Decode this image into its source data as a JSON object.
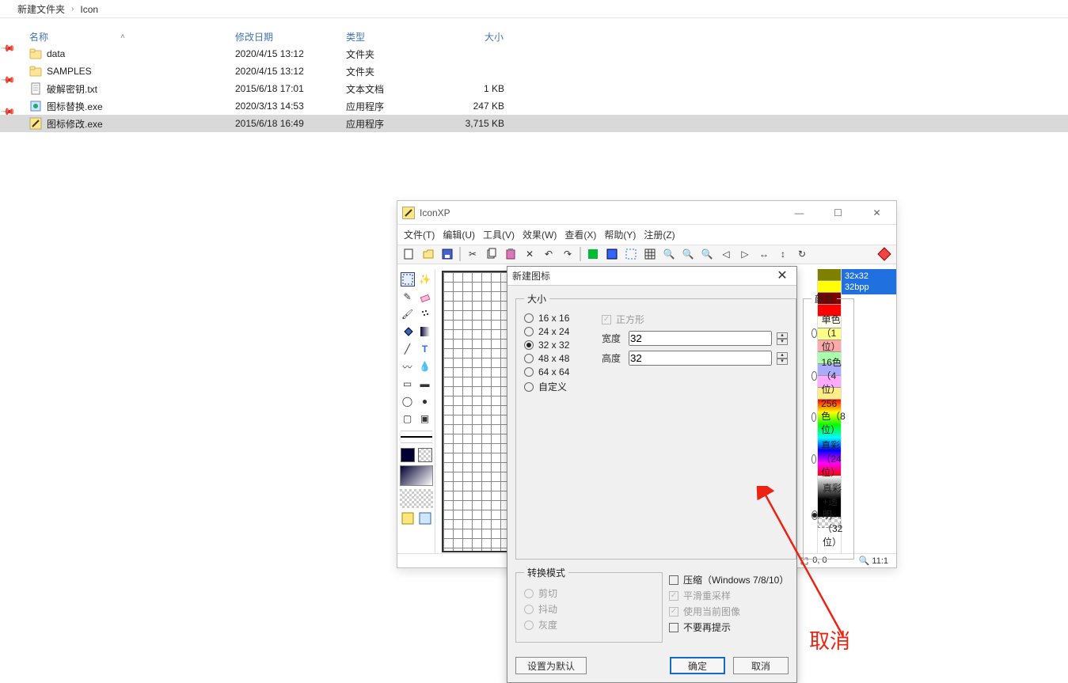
{
  "breadcrumb": {
    "parent": "新建文件夹",
    "current": "Icon"
  },
  "explorer": {
    "columns": {
      "name": "名称",
      "date": "修改日期",
      "type": "类型",
      "size": "大小"
    },
    "rows": [
      {
        "icon": "folder",
        "name": "data",
        "date": "2020/4/15 13:12",
        "type": "文件夹",
        "size": ""
      },
      {
        "icon": "folder",
        "name": "SAMPLES",
        "date": "2020/4/15 13:12",
        "type": "文件夹",
        "size": ""
      },
      {
        "icon": "txt",
        "name": "破解密钥.txt",
        "date": "2015/6/18 17:01",
        "type": "文本文档",
        "size": "1 KB"
      },
      {
        "icon": "exe",
        "name": "图标替换.exe",
        "date": "2020/3/13 14:53",
        "type": "应用程序",
        "size": "247 KB"
      },
      {
        "icon": "ico",
        "name": "图标修改.exe",
        "date": "2015/6/18 16:49",
        "type": "应用程序",
        "size": "3,715 KB",
        "selected": true
      }
    ]
  },
  "app": {
    "title": "IconXP",
    "menu": [
      "文件(T)",
      "编辑(U)",
      "工具(V)",
      "效果(W)",
      "查看(X)",
      "帮助(Y)",
      "注册(Z)"
    ],
    "right_panel": {
      "line1": "32x32",
      "line2": "32bpp"
    },
    "status": {
      "pos": "0, 0",
      "zoom": "11:1"
    }
  },
  "dialog": {
    "title": "新建图标",
    "groups": {
      "size": "大小",
      "colors": "颜色",
      "convert": "转换模式"
    },
    "sizes": [
      "16 x 16",
      "24 x 24",
      "32 x 32",
      "48 x 48",
      "64 x 64",
      "自定义"
    ],
    "size_selected": "32 x 32",
    "square": "正方形",
    "width_label": "宽度",
    "width_value": "32",
    "height_label": "高度",
    "height_value": "32",
    "color_opts": [
      "单色（1位）",
      "16色（4位）",
      "256色（8位）",
      "真彩（24位）",
      "真彩+透明（32位）"
    ],
    "color_selected": "真彩+透明（32位）",
    "convert_opts": [
      "剪切",
      "抖动",
      "灰度"
    ],
    "compress": "压缩（Windows 7/8/10）",
    "smooth": "平滑重采样",
    "usecurrent": "使用当前图像",
    "noremind": "不要再提示",
    "btn_default": "设置为默认",
    "btn_ok": "确定",
    "btn_cancel": "取消"
  },
  "annotation": "取消"
}
